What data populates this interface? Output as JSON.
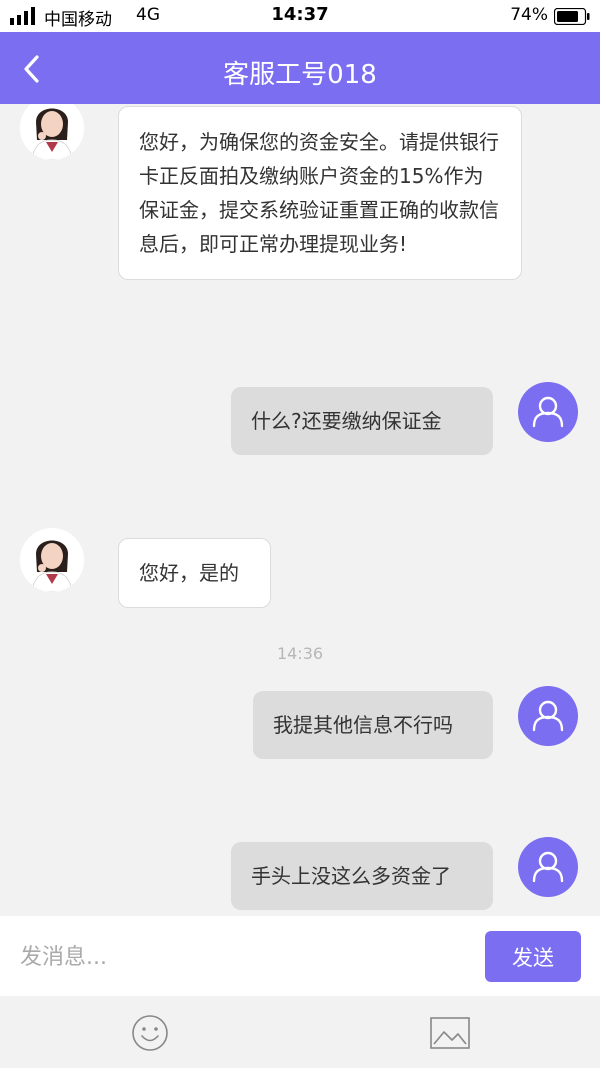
{
  "status_bar": {
    "carrier": "中国移动",
    "network": "4G",
    "time": "14:37",
    "battery": "74%"
  },
  "header": {
    "title": "客服工号018",
    "back_icon": "chevron-left-icon"
  },
  "messages": [
    {
      "sender": "agent",
      "text": "您好，为确保您的资金安全。请提供银行卡正反面拍及缴纳账户资金的15%作为保证金，提交系统验证重置正确的收款信息后，即可正常办理提现业务!"
    },
    {
      "sender": "user",
      "text": "什么?还要缴纳保证金"
    },
    {
      "sender": "agent",
      "text": "您好，是的"
    },
    {
      "sender": "user",
      "text": "我提其他信息不行吗"
    },
    {
      "sender": "user",
      "text": "手头上没这么多资金了"
    }
  ],
  "timestamp_divider": "14:36",
  "composer": {
    "placeholder": "发消息...",
    "send_label": "发送"
  },
  "toolbar": {
    "emoji_icon": "smiley-icon",
    "image_icon": "image-icon"
  },
  "colors": {
    "accent": "#7b6ef0",
    "background": "#f2f2f2",
    "outgoing_bubble": "#dcdcdc"
  }
}
